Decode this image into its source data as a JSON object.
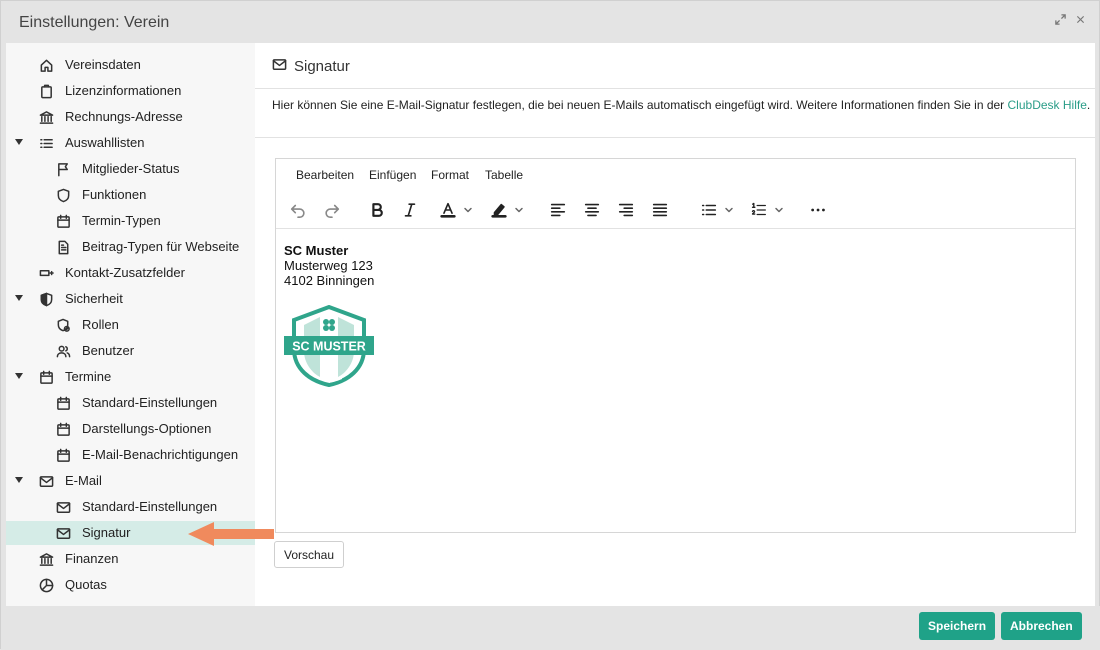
{
  "window": {
    "title": "Einstellungen: Verein"
  },
  "sidebar": {
    "items": [
      {
        "label": "Vereinsdaten"
      },
      {
        "label": "Lizenzinformationen"
      },
      {
        "label": "Rechnungs-Adresse"
      },
      {
        "label": "Auswahllisten"
      },
      {
        "label": "Mitglieder-Status"
      },
      {
        "label": "Funktionen"
      },
      {
        "label": "Termin-Typen"
      },
      {
        "label": "Beitrag-Typen für Webseite"
      },
      {
        "label": "Kontakt-Zusatzfelder"
      },
      {
        "label": "Sicherheit"
      },
      {
        "label": "Rollen"
      },
      {
        "label": "Benutzer"
      },
      {
        "label": "Termine"
      },
      {
        "label": "Standard-Einstellungen"
      },
      {
        "label": "Darstellungs-Optionen"
      },
      {
        "label": "E-Mail-Benachrichtigungen"
      },
      {
        "label": "E-Mail"
      },
      {
        "label": "Standard-Einstellungen"
      },
      {
        "label": "Signatur"
      },
      {
        "label": "Finanzen"
      },
      {
        "label": "Quotas"
      }
    ]
  },
  "panel": {
    "title": "Signatur",
    "description": "Hier können Sie eine E-Mail-Signatur festlegen, die bei neuen E-Mails automatisch eingefügt wird. Weitere Informationen finden Sie in der ",
    "help_link": "ClubDesk Hilfe",
    "description_end": "."
  },
  "editor": {
    "menu": {
      "edit": "Bearbeiten",
      "insert": "Einfügen",
      "format": "Format",
      "table": "Tabelle"
    },
    "content": {
      "line1": "SC Muster",
      "line2": "Musterweg 123",
      "line3": "4102 Binningen"
    },
    "logo_text": "SC MUSTER"
  },
  "buttons": {
    "preview": "Vorschau",
    "save": "Speichern",
    "cancel": "Abbrechen"
  },
  "colors": {
    "accent": "#1fa288",
    "active_item_bg": "#d5ece7",
    "arrow": "#f08a5d"
  }
}
